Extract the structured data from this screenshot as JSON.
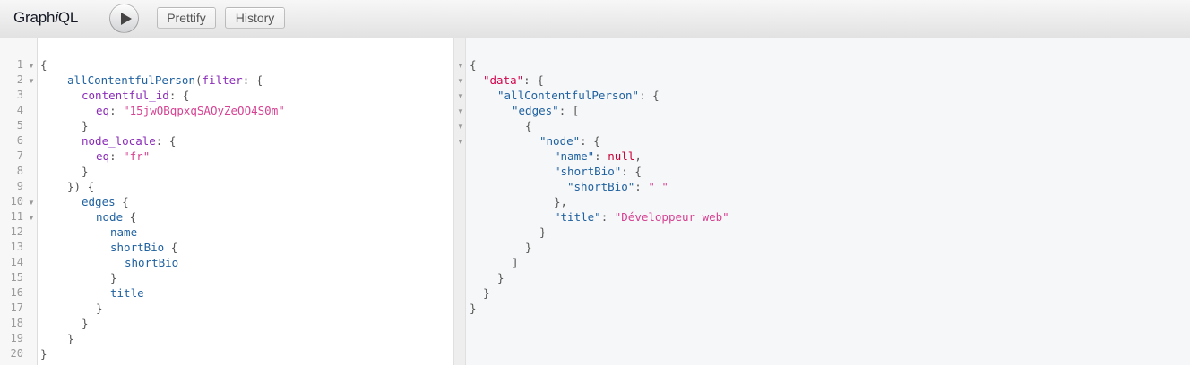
{
  "header": {
    "title_prefix": "Graph",
    "title_italic": "i",
    "title_suffix": "QL",
    "run_icon": "play-icon",
    "prettify_label": "Prettify",
    "history_label": "History"
  },
  "query": {
    "line_numbers": [
      "1",
      "2",
      "3",
      "4",
      "5",
      "6",
      "7",
      "8",
      "9",
      "10",
      "11",
      "12",
      "13",
      "14",
      "15",
      "16",
      "17",
      "18",
      "19",
      "20"
    ],
    "fold_icon": "fold-arrow-icon",
    "tokens": {
      "l1": "{",
      "l2a": "allContentfulPerson",
      "l2b": "(",
      "l2c": "filter",
      "l2d": ": {",
      "l3a": "contentful_id",
      "l3b": ": {",
      "l4a": "eq",
      "l4b": ": ",
      "l4c": "\"15jwOBqpxqSAOyZeOO4S0m\"",
      "l5": "}",
      "l6a": "node_locale",
      "l6b": ": {",
      "l7a": "eq",
      "l7b": ": ",
      "l7c": "\"fr\"",
      "l8": "}",
      "l9": "}) {",
      "l10a": "edges",
      "l10b": " {",
      "l11a": "node",
      "l11b": " {",
      "l12": "name",
      "l13a": "shortBio",
      "l13b": " {",
      "l14": "shortBio",
      "l15": "}",
      "l16": "title",
      "l17": "}",
      "l18": "}",
      "l19": "}",
      "l20": "}"
    }
  },
  "result": {
    "fold_icon": "fold-arrow-icon",
    "tokens": {
      "r1": "{",
      "r2a": "\"data\"",
      "r2b": ": {",
      "r3a": "\"allContentfulPerson\"",
      "r3b": ": {",
      "r4a": "\"edges\"",
      "r4b": ": [",
      "r5": "{",
      "r6a": "\"node\"",
      "r6b": ": {",
      "r7a": "\"name\"",
      "r7b": ": ",
      "r7c": "null",
      "r7d": ",",
      "r8a": "\"shortBio\"",
      "r8b": ": {",
      "r9a": "\"shortBio\"",
      "r9b": ": ",
      "r9c": "\" \"",
      "r10": "},",
      "r11a": "\"title\"",
      "r11b": ": ",
      "r11c": "\"Développeur web\"",
      "r12": "}",
      "r13": "}",
      "r14": "]",
      "r15": "}",
      "r16": "}",
      "r17": "}"
    }
  }
}
